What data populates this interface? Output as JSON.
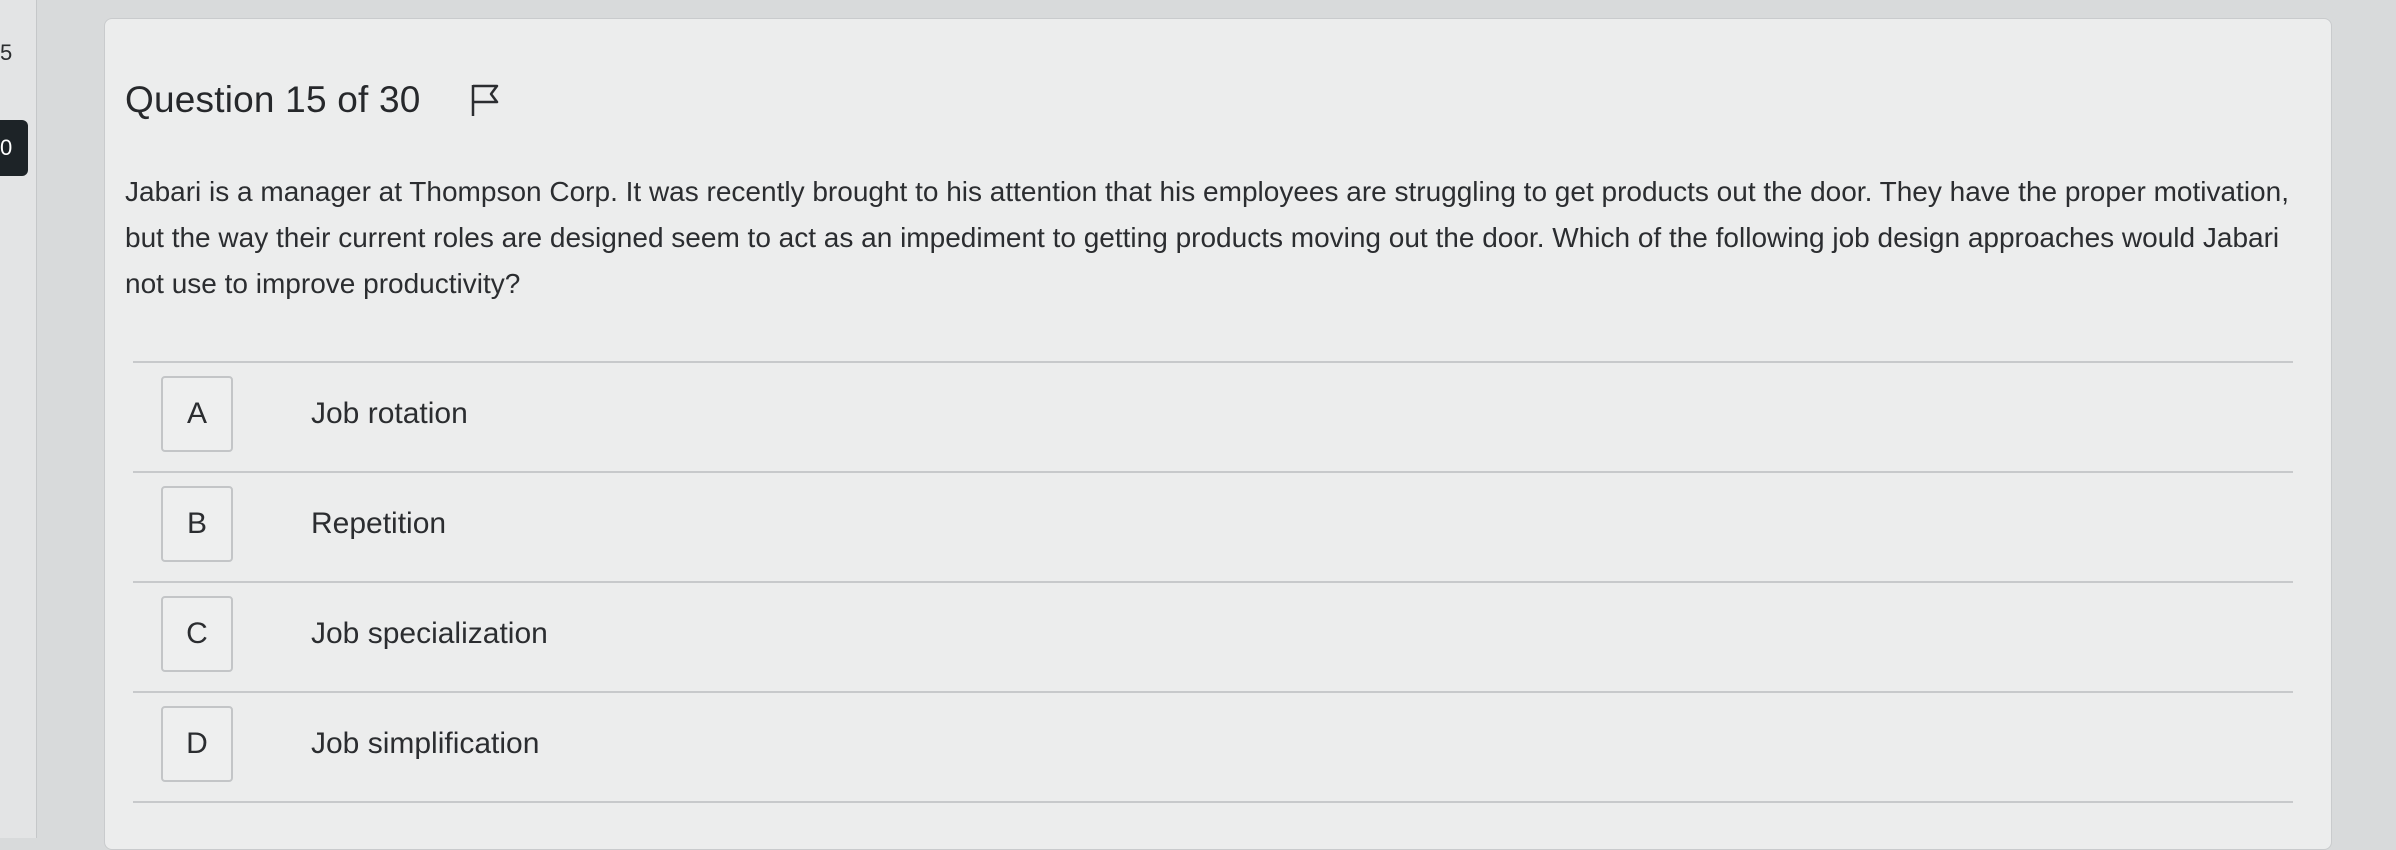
{
  "sidebar": {
    "numbers": [
      "5",
      "0"
    ]
  },
  "question": {
    "header": "Question 15 of 30",
    "text": "Jabari is a manager at Thompson Corp. It was recently brought to his attention that his employees are struggling to get products out the door. They have the proper motivation, but the way their current roles are designed seem to act as an impediment to getting products moving out the door. Which of the following job design approaches would Jabari not use to improve productivity?"
  },
  "options": [
    {
      "letter": "A",
      "text": "Job rotation"
    },
    {
      "letter": "B",
      "text": "Repetition"
    },
    {
      "letter": "C",
      "text": "Job specialization"
    },
    {
      "letter": "D",
      "text": "Job simplification"
    }
  ],
  "colors": {
    "background": "#d8dadb",
    "card": "#eceded",
    "text": "#2b2d30",
    "sidebar_active": "#1d2327"
  }
}
